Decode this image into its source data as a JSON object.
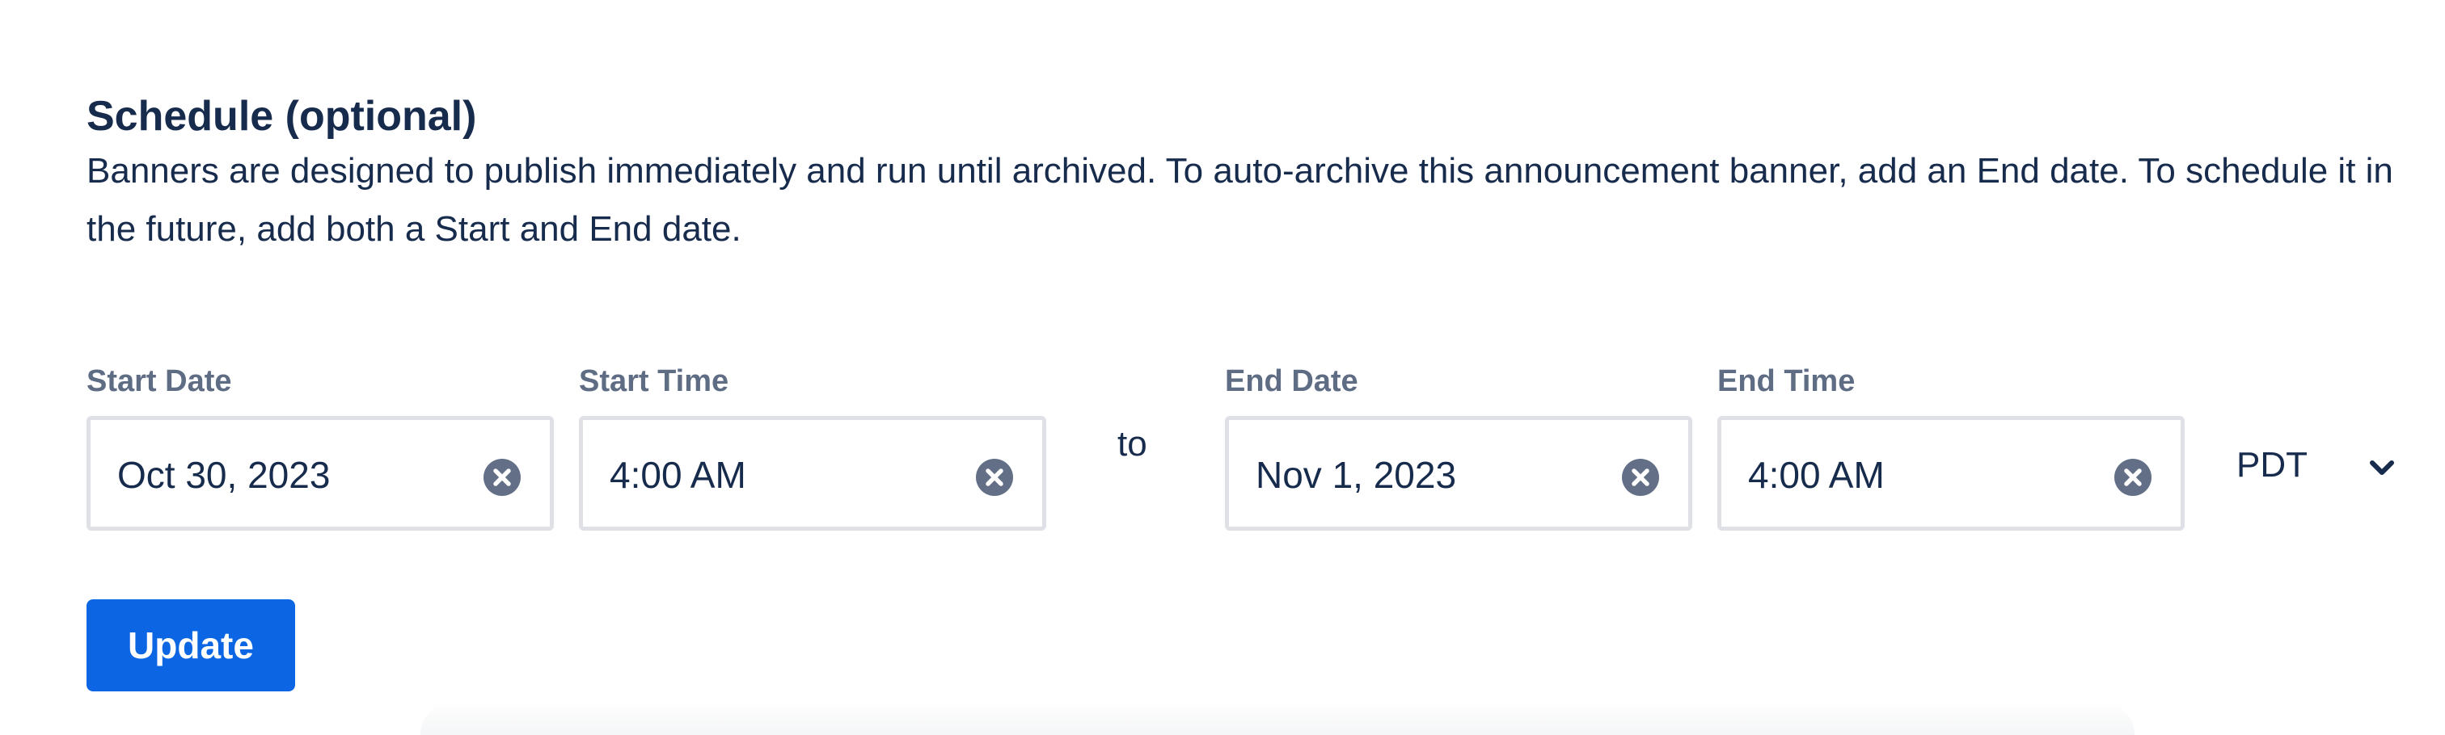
{
  "schedule": {
    "title": "Schedule (optional)",
    "description": "Banners are designed to publish immediately and run until archived. To auto-archive this announcement banner, add an End date. To schedule it in the future, add both a Start and End date."
  },
  "start_date": {
    "label": "Start Date",
    "value": "Oct 30, 2023",
    "clear_icon": "clear-icon"
  },
  "start_time": {
    "label": "Start Time",
    "value": "4:00 AM",
    "clear_icon": "clear-icon"
  },
  "separator": "to",
  "end_date": {
    "label": "End Date",
    "value": "Nov 1, 2023",
    "clear_icon": "clear-icon"
  },
  "end_time": {
    "label": "End Time",
    "value": "4:00 AM",
    "clear_icon": "clear-icon"
  },
  "timezone": {
    "value": "PDT",
    "icon": "chevron-down-icon"
  },
  "actions": {
    "update_label": "Update"
  },
  "colors": {
    "text": "#172b4d",
    "label": "#5e6c84",
    "border": "#dfe1e6",
    "icon": "#626f86",
    "primary": "#0c66e4"
  }
}
